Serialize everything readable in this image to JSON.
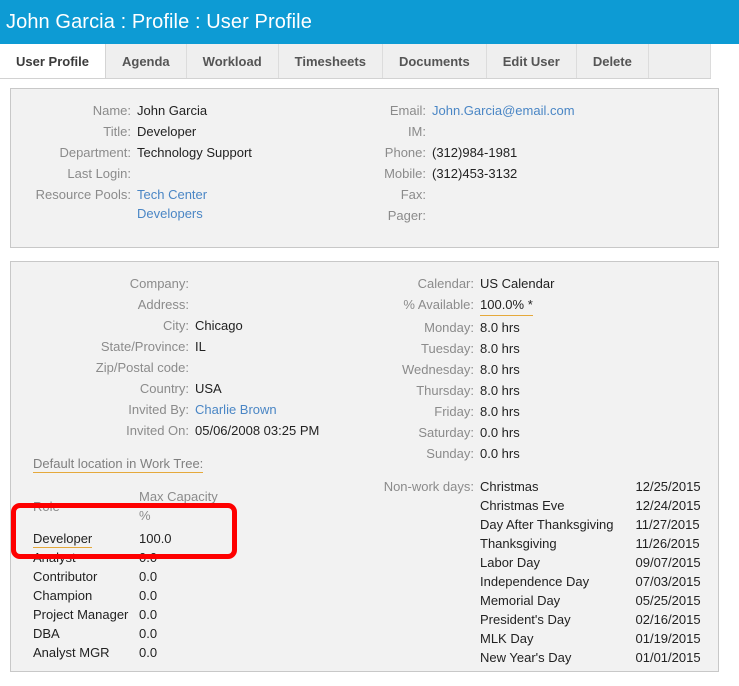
{
  "header": {
    "title": "John Garcia : Profile : User Profile",
    "accent_color": "#0d9bd4"
  },
  "tabs": [
    {
      "label": "User Profile",
      "active": true
    },
    {
      "label": "Agenda",
      "active": false
    },
    {
      "label": "Workload",
      "active": false
    },
    {
      "label": "Timesheets",
      "active": false
    },
    {
      "label": "Documents",
      "active": false
    },
    {
      "label": "Edit User",
      "active": false
    },
    {
      "label": "Delete",
      "active": false
    }
  ],
  "contact_panel": {
    "left": [
      {
        "label": "Name:",
        "value": "John Garcia",
        "kind": "text"
      },
      {
        "label": "Title:",
        "value": "Developer",
        "kind": "text"
      },
      {
        "label": "Department:",
        "value": "Technology Support",
        "kind": "text"
      },
      {
        "label": "Last Login:",
        "value": "",
        "kind": "text"
      }
    ],
    "resource_pools_label": "Resource Pools:",
    "resource_pools": [
      "Tech Center",
      "Developers"
    ],
    "right": [
      {
        "label": "Email:",
        "value": "John.Garcia@email.com",
        "kind": "link"
      },
      {
        "label": "IM:",
        "value": "",
        "kind": "text"
      },
      {
        "label": "Phone:",
        "value": "(312)984-1981",
        "kind": "text"
      },
      {
        "label": "Mobile:",
        "value": "(312)453-3132",
        "kind": "text"
      },
      {
        "label": "Fax:",
        "value": "",
        "kind": "text"
      },
      {
        "label": "Pager:",
        "value": "",
        "kind": "text"
      }
    ]
  },
  "details_panel": {
    "left": [
      {
        "label": "Company:",
        "value": "",
        "kind": "text"
      },
      {
        "label": "Address:",
        "value": "",
        "kind": "text"
      },
      {
        "label": "City:",
        "value": "Chicago",
        "kind": "text"
      },
      {
        "label": "State/Province:",
        "value": "IL",
        "kind": "text"
      },
      {
        "label": "Zip/Postal code:",
        "value": "",
        "kind": "text"
      },
      {
        "label": "Country:",
        "value": "USA",
        "kind": "text"
      },
      {
        "label": "Invited By:",
        "value": "Charlie Brown",
        "kind": "link"
      },
      {
        "label": "Invited On:",
        "value": "05/06/2008 03:25 PM",
        "kind": "text"
      }
    ],
    "work_tree_label": "Default location in Work Tree:",
    "right": [
      {
        "label": "Calendar:",
        "value": "US Calendar",
        "kind": "text"
      },
      {
        "label": "% Available:",
        "value": "100.0% *",
        "kind": "dotted"
      },
      {
        "label": "Monday:",
        "value": "8.0 hrs",
        "kind": "text"
      },
      {
        "label": "Tuesday:",
        "value": "8.0 hrs",
        "kind": "text"
      },
      {
        "label": "Wednesday:",
        "value": "8.0 hrs",
        "kind": "text"
      },
      {
        "label": "Thursday:",
        "value": "8.0 hrs",
        "kind": "text"
      },
      {
        "label": "Friday:",
        "value": "8.0 hrs",
        "kind": "text"
      },
      {
        "label": "Saturday:",
        "value": "0.0 hrs",
        "kind": "text"
      },
      {
        "label": "Sunday:",
        "value": "0.0 hrs",
        "kind": "text"
      }
    ],
    "role_table": {
      "columns": [
        "Role",
        "Max Capacity %"
      ],
      "rows": [
        {
          "role": "Developer",
          "capacity": "100.0",
          "highlighted": true
        },
        {
          "role": "Analyst",
          "capacity": "0.0",
          "highlighted": false
        },
        {
          "role": "Contributor",
          "capacity": "0.0",
          "highlighted": false
        },
        {
          "role": "Champion",
          "capacity": "0.0",
          "highlighted": false
        },
        {
          "role": "Project Manager",
          "capacity": "0.0",
          "highlighted": false
        },
        {
          "role": "DBA",
          "capacity": "0.0",
          "highlighted": false
        },
        {
          "role": "Analyst MGR",
          "capacity": "0.0",
          "highlighted": false
        }
      ]
    },
    "non_work_days_label": "Non-work days:",
    "non_work_days": [
      {
        "name": "Christmas",
        "date": "12/25/2015"
      },
      {
        "name": "Christmas Eve",
        "date": "12/24/2015"
      },
      {
        "name": "Day After Thanksgiving",
        "date": "11/27/2015"
      },
      {
        "name": "Thanksgiving",
        "date": "11/26/2015"
      },
      {
        "name": "Labor Day",
        "date": "09/07/2015"
      },
      {
        "name": "Independence Day",
        "date": "07/03/2015"
      },
      {
        "name": "Memorial Day",
        "date": "05/25/2015"
      },
      {
        "name": "President's Day",
        "date": "02/16/2015"
      },
      {
        "name": "MLK Day",
        "date": "01/19/2015"
      },
      {
        "name": "New Year's Day",
        "date": "01/01/2015"
      }
    ]
  },
  "annotation": {
    "shape": "rounded-rectangle",
    "color": "#fe0000"
  }
}
